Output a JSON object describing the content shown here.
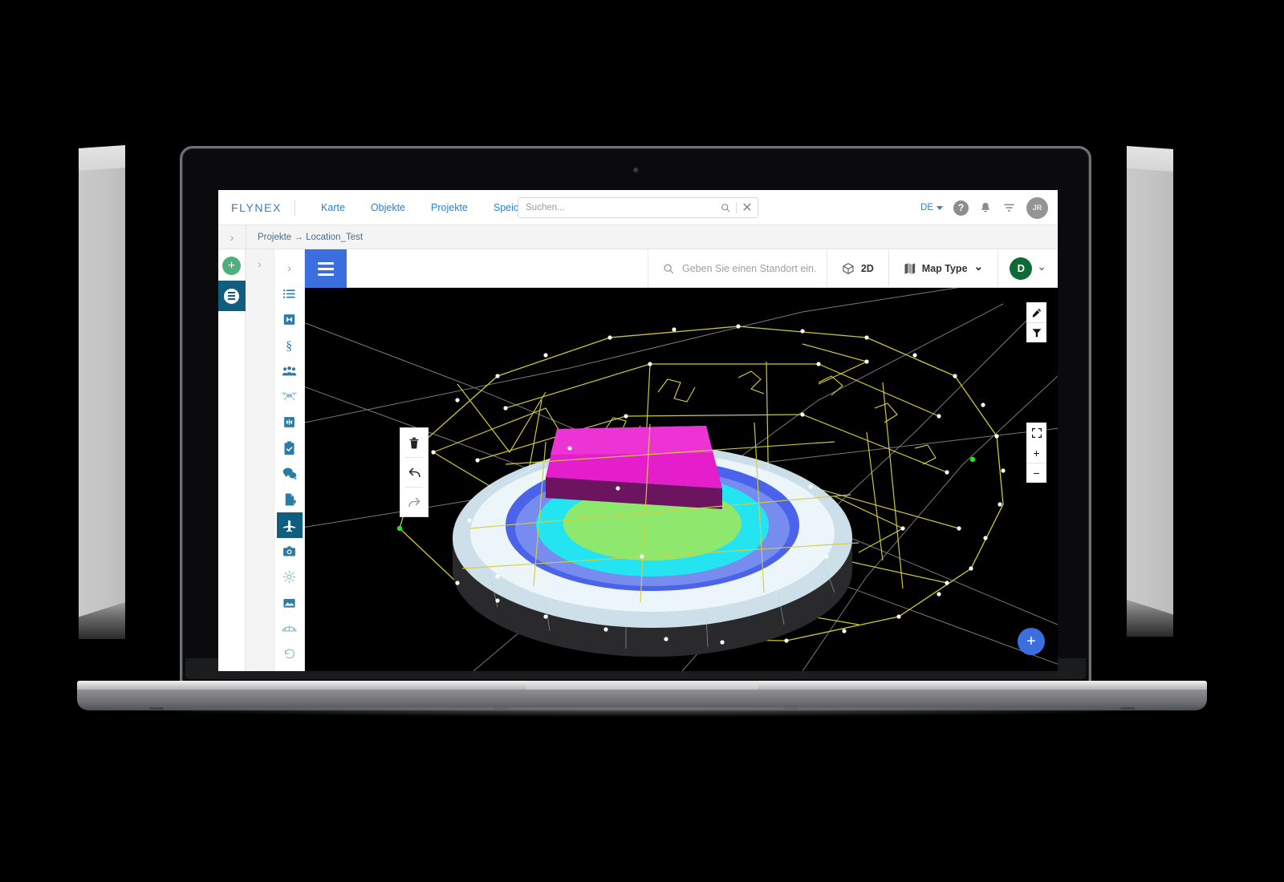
{
  "brand": {
    "name": "FLYNEX"
  },
  "topnav": {
    "links": [
      {
        "label": "Karte",
        "name": "nav-karte"
      },
      {
        "label": "Objekte",
        "name": "nav-objekte"
      },
      {
        "label": "Projekte",
        "name": "nav-projekte"
      },
      {
        "label": "Speicher",
        "name": "nav-speicher"
      }
    ],
    "search": {
      "value": "",
      "placeholder": "Suchen...",
      "search_icon": "search-icon",
      "clear_label": "✕"
    },
    "language": "DE",
    "help_icon": "question-mark-icon",
    "notifications_icon": "bell-icon",
    "filter_icon": "filter-icon",
    "avatar_initials": "JR"
  },
  "breadcrumb": {
    "expand_icon": "›",
    "text": "Projekte → Location_Test"
  },
  "rail_primary": {
    "add_label": "+",
    "selected_item_name": "layers-stack-icon"
  },
  "rail_secondary": {
    "expand_icon": "›"
  },
  "rail_tools": {
    "expand_icon": "›",
    "items": [
      {
        "name": "list-icon",
        "label": "Liste"
      },
      {
        "name": "map-flag-icon",
        "label": "Karte"
      },
      {
        "name": "paragraph-icon",
        "label": "Paragraph"
      },
      {
        "name": "people-group-icon",
        "label": "Team"
      },
      {
        "name": "drone-icon",
        "label": "Drohne"
      },
      {
        "name": "airspace-icon",
        "label": "Luftraum"
      },
      {
        "name": "clipboard-check-icon",
        "label": "Checkliste"
      },
      {
        "name": "chat-bubbles-icon",
        "label": "Kommentare"
      },
      {
        "name": "document-add-icon",
        "label": "Dokument"
      },
      {
        "name": "airplane-icon",
        "label": "Flugplanung",
        "selected": true
      },
      {
        "name": "camera-icon",
        "label": "Kamera"
      },
      {
        "name": "sun-weather-icon",
        "label": "Wetter"
      },
      {
        "name": "terrain-icon",
        "label": "Gelaende"
      },
      {
        "name": "bridge-icon",
        "label": "Bruecke"
      },
      {
        "name": "history-icon",
        "label": "Verlauf"
      }
    ]
  },
  "map_header": {
    "menu_icon": "hamburger-icon",
    "location_search": {
      "value": "",
      "placeholder": "Geben Sie einen Standort ein.",
      "icon": "search-icon"
    },
    "view_mode": {
      "label": "2D",
      "icon": "cube-icon"
    },
    "map_type": {
      "label": "Map Type",
      "icon": "map-icon",
      "caret": "⌄"
    },
    "user": {
      "initials": "D",
      "caret": "⌄"
    }
  },
  "edit_tools": [
    {
      "name": "delete-icon",
      "label": "Löschen"
    },
    {
      "name": "undo-icon",
      "label": "Rückgängig"
    },
    {
      "name": "redo-icon",
      "label": "Wiederholen"
    }
  ],
  "map_controls": {
    "top": [
      {
        "name": "pencil-edit-icon",
        "label": "Bearbeiten"
      },
      {
        "name": "filter-icon",
        "label": "Filter"
      }
    ],
    "zoom": [
      {
        "name": "fullscreen-icon",
        "label": "Vollbild"
      },
      {
        "name": "zoom-in-icon",
        "label": "+"
      },
      {
        "name": "zoom-out-icon",
        "label": "−"
      }
    ],
    "fab": {
      "name": "add-fab",
      "label": "+"
    }
  },
  "scene": {
    "description": "3D stadium model with yellow drone flight path waypoints",
    "background": "#000000",
    "colors": {
      "flight_path": "#d6d13a",
      "waypoint": "#ffffff",
      "waypoint_start": "#27e22a",
      "grid_line": "#9a9a9a",
      "roof_magenta": "#e21ecb",
      "roof_magenta_side": "#6e1460",
      "pitch_green": "#8ae86a",
      "tier_cyan": "#22e6f0",
      "tier_blue": "#3a5bef",
      "shell_light": "#cfe6f4",
      "base_dark": "#2a2a2a"
    }
  }
}
